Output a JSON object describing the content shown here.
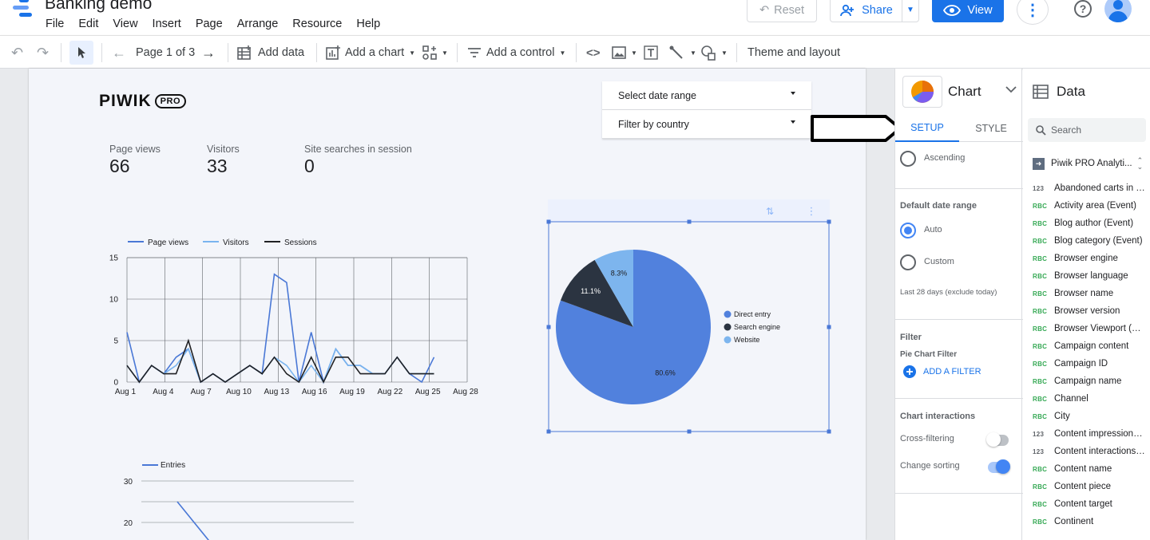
{
  "app": {
    "title": "Banking demo",
    "menu": [
      "File",
      "Edit",
      "View",
      "Insert",
      "Page",
      "Arrange",
      "Resource",
      "Help"
    ],
    "reset_label": "Reset",
    "share_label": "Share",
    "view_label": "View",
    "logo_colors": [
      "#1a73e8",
      "#669df6",
      "#aecbfa"
    ]
  },
  "toolbar": {
    "page_label": "Page 1 of 3",
    "add_data": "Add data",
    "add_chart": "Add a chart",
    "add_control": "Add a control",
    "theme_layout": "Theme and layout"
  },
  "report": {
    "brand": "PIWIK",
    "brand_badge": "PRO",
    "kpis": [
      {
        "label": "Page views",
        "value": "66"
      },
      {
        "label": "Visitors",
        "value": "33"
      },
      {
        "label": "Site searches in session",
        "value": "0"
      }
    ],
    "controls": [
      {
        "label": "Select date range"
      },
      {
        "label": "Filter by country"
      }
    ]
  },
  "chart_data": [
    {
      "type": "line",
      "title": "",
      "x": [
        "Aug 1",
        "Aug 2",
        "Aug 3",
        "Aug 4",
        "Aug 5",
        "Aug 6",
        "Aug 7",
        "Aug 8",
        "Aug 9",
        "Aug 10",
        "Aug 11",
        "Aug 12",
        "Aug 13",
        "Aug 14",
        "Aug 15",
        "Aug 16",
        "Aug 17",
        "Aug 18",
        "Aug 19",
        "Aug 20",
        "Aug 21",
        "Aug 22",
        "Aug 23",
        "Aug 24",
        "Aug 25",
        "Aug 26",
        "Aug 27"
      ],
      "xticks": [
        "Aug 1",
        "Aug 4",
        "Aug 7",
        "Aug 10",
        "Aug 13",
        "Aug 16",
        "Aug 19",
        "Aug 22",
        "Aug 25",
        "Aug 28"
      ],
      "yticks": [
        "0",
        "5",
        "10",
        "15"
      ],
      "ylim": [
        0,
        15
      ],
      "grid": true,
      "legend": "top",
      "series": [
        {
          "name": "Page views",
          "color": "#4a78d6",
          "values": [
            6,
            0,
            2,
            1,
            3,
            4,
            0,
            1,
            0,
            1,
            2,
            1,
            13,
            12,
            0,
            6,
            0,
            4,
            2,
            2,
            1,
            1,
            3,
            1,
            0,
            3,
            null
          ]
        },
        {
          "name": "Visitors",
          "color": "#79b4ef",
          "values": [
            2,
            0,
            2,
            1,
            2,
            4,
            0,
            1,
            0,
            1,
            2,
            1,
            3,
            2,
            0,
            2,
            0,
            4,
            2,
            2,
            1,
            1,
            3,
            1,
            1,
            1,
            null
          ]
        },
        {
          "name": "Sessions",
          "color": "#202124",
          "values": [
            2,
            0,
            2,
            1,
            1,
            5,
            0,
            1,
            0,
            1,
            2,
            1,
            3,
            1,
            0,
            3,
            0,
            3,
            3,
            1,
            1,
            1,
            3,
            1,
            1,
            1,
            null
          ]
        }
      ]
    },
    {
      "type": "pie",
      "legend": "right",
      "slices": [
        {
          "name": "Direct entry",
          "value": 80.6,
          "label": "80.6%",
          "color": "#5181dd"
        },
        {
          "name": "Search engine",
          "value": 11.1,
          "label": "11.1%",
          "color": "#2b3441"
        },
        {
          "name": "Website",
          "value": 8.3,
          "label": "8.3%",
          "color": "#7db5ee"
        }
      ]
    },
    {
      "type": "line",
      "legend": "top",
      "yticks": [
        "20",
        "30"
      ],
      "series": [
        {
          "name": "Entries",
          "color": "#4a78d6"
        }
      ]
    }
  ],
  "props": {
    "title": "Chart",
    "tab_setup": "SETUP",
    "tab_style": "STYLE",
    "ascending": "Ascending",
    "default_date_range": "Default date range",
    "auto": "Auto",
    "custom": "Custom",
    "last28": "Last 28 days (exclude today)",
    "filter": "Filter",
    "pie_filter": "Pie Chart Filter",
    "add_filter": "ADD A FILTER",
    "interactions": "Chart interactions",
    "cross_filtering": "Cross-filtering",
    "change_sorting": "Change sorting",
    "accent": "#1a73e8"
  },
  "datapanel": {
    "title": "Data",
    "search_placeholder": "Search",
    "source": "Piwik PRO Analyti...",
    "fields": [
      {
        "type": "123",
        "name": "Abandoned carts in s..."
      },
      {
        "type": "RBC",
        "name": "Activity area (Event)"
      },
      {
        "type": "RBC",
        "name": "Blog author (Event)"
      },
      {
        "type": "RBC",
        "name": "Blog category (Event)"
      },
      {
        "type": "RBC",
        "name": "Browser engine"
      },
      {
        "type": "RBC",
        "name": "Browser language"
      },
      {
        "type": "RBC",
        "name": "Browser name"
      },
      {
        "type": "RBC",
        "name": "Browser version"
      },
      {
        "type": "RBC",
        "name": "Browser Viewport (Se..."
      },
      {
        "type": "RBC",
        "name": "Campaign content"
      },
      {
        "type": "RBC",
        "name": "Campaign ID"
      },
      {
        "type": "RBC",
        "name": "Campaign name"
      },
      {
        "type": "RBC",
        "name": "Channel"
      },
      {
        "type": "RBC",
        "name": "City"
      },
      {
        "type": "123",
        "name": "Content impressions ..."
      },
      {
        "type": "123",
        "name": "Content interactions i..."
      },
      {
        "type": "RBC",
        "name": "Content name"
      },
      {
        "type": "RBC",
        "name": "Content piece"
      },
      {
        "type": "RBC",
        "name": "Content target"
      },
      {
        "type": "RBC",
        "name": "Continent"
      }
    ]
  }
}
